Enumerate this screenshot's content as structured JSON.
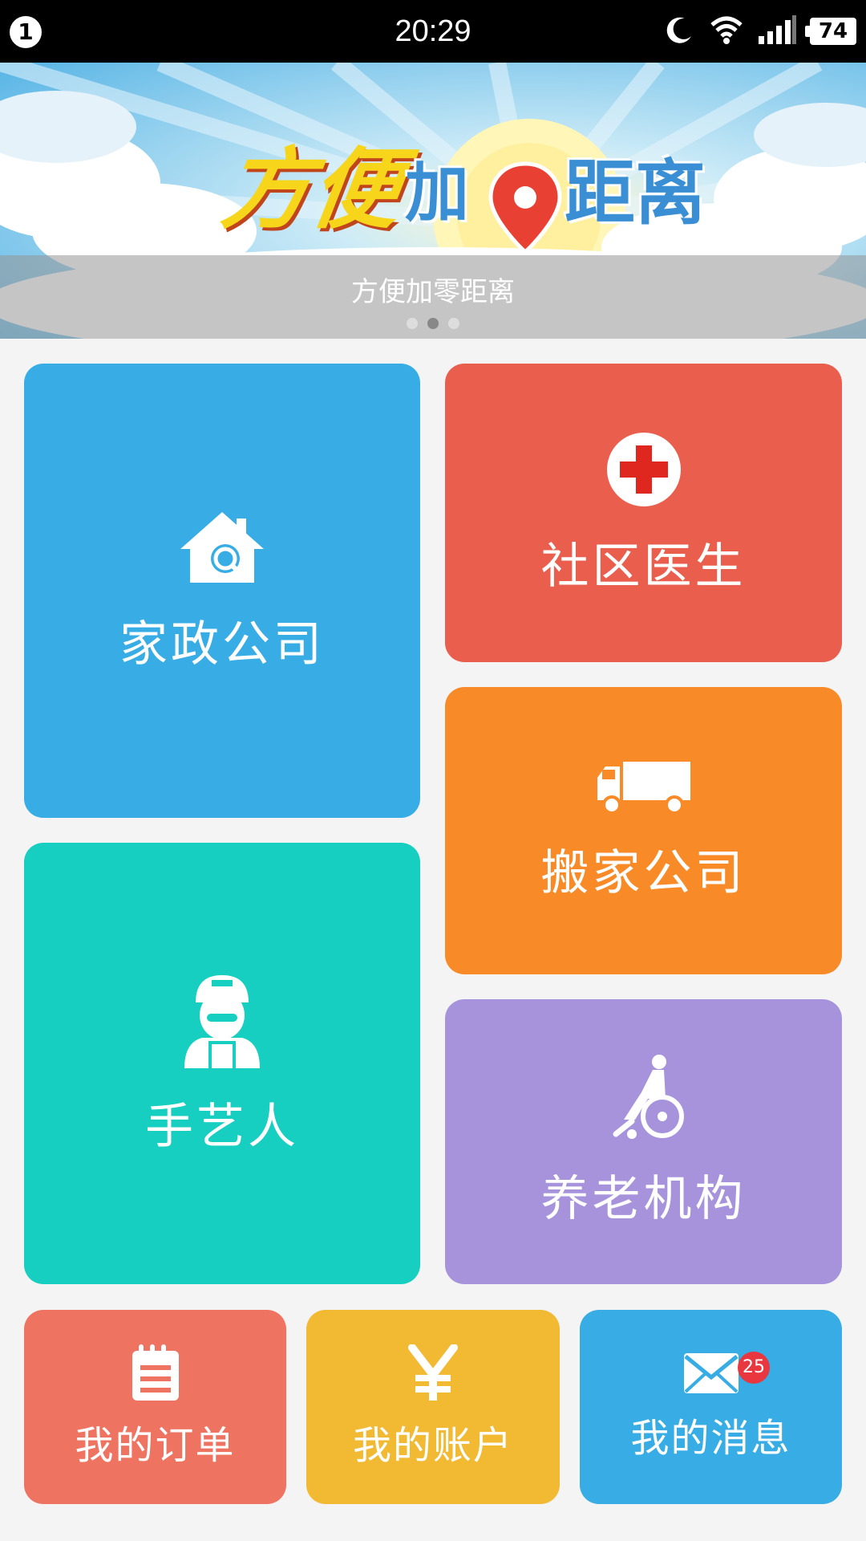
{
  "status_bar": {
    "notification_count": "1",
    "time": "20:29",
    "battery": "74",
    "icons": [
      "moon-icon",
      "wifi-icon",
      "signal-icon",
      "battery-icon"
    ]
  },
  "banner": {
    "logo_text_1": "方便",
    "logo_text_2": "加",
    "logo_text_3": "距离",
    "caption": "方便加零距离",
    "slides_count": 3,
    "active_slide": 2
  },
  "tiles": {
    "housekeeping": {
      "label": "家政公司",
      "icon": "house-search-icon",
      "color": "#37ace5"
    },
    "doctor": {
      "label": "社区医生",
      "icon": "red-cross-icon",
      "color": "#e95e4c"
    },
    "moving": {
      "label": "搬家公司",
      "icon": "truck-icon",
      "color": "#f88a27"
    },
    "craftsman": {
      "label": "手艺人",
      "icon": "worker-icon",
      "color": "#16cfc0"
    },
    "elderly": {
      "label": "养老机构",
      "icon": "wheelchair-icon",
      "color": "#a693dc"
    }
  },
  "bottom_nav": {
    "orders": {
      "label": "我的订单",
      "icon": "notepad-icon",
      "color": "#ef7361"
    },
    "account": {
      "label": "我的账户",
      "icon": "yen-icon",
      "color": "#f2b933"
    },
    "messages": {
      "label": "我的消息",
      "icon": "envelope-icon",
      "color": "#37ace5",
      "badge": "25"
    }
  }
}
